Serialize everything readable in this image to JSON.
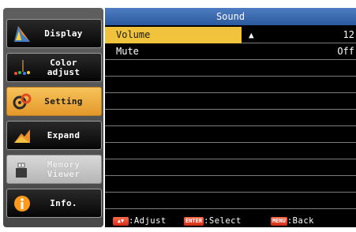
{
  "sidebar": {
    "items": [
      {
        "label": "Display",
        "icon": "display-icon"
      },
      {
        "label": "Color adjust",
        "icon": "color-adjust-icon"
      },
      {
        "label": "Setting",
        "icon": "setting-icon",
        "active": true
      },
      {
        "label": "Expand",
        "icon": "expand-icon"
      },
      {
        "label": "Memory\nViewer",
        "icon": "memory-viewer-icon",
        "disabled": true
      },
      {
        "label": "Info.",
        "icon": "info-icon"
      }
    ]
  },
  "panel": {
    "title": "Sound",
    "rows": [
      {
        "label": "Volume",
        "value": "12",
        "selected": true,
        "adjust_icon": "up-down-arrows-icon"
      },
      {
        "label": "Mute",
        "value": "Off"
      }
    ]
  },
  "footer": {
    "adjust_label": ":Adjust",
    "enter_key": "ENTER",
    "select_label": ":Select",
    "menu_key": "MENU",
    "back_label": ":Back"
  },
  "colors": {
    "highlight": "#f1c23b",
    "title_bar": "#3a6bb5",
    "active_tab": "#f0b24a",
    "key_red": "#e23a1f"
  }
}
